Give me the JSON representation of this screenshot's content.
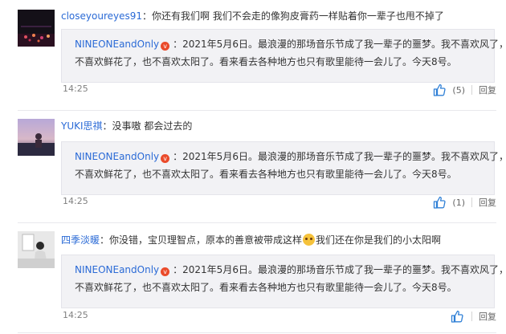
{
  "comments": [
    {
      "username": "closeyoureyes91",
      "text": "：你还有我们啊 我们不会走的像狗皮膏药一样贴着你一辈子也甩不掉了",
      "quote": {
        "username": "NINEONEandOnly",
        "badge": "v",
        "line1": "：2021年5月6日。最浪漫的那场音乐节成了我一辈子的噩梦。我不喜欢风了，",
        "line2": "不喜欢鲜花了，也不喜欢太阳了。看来看去各种地方也只有歌里能待一会儿了。今天8号。"
      },
      "time": "14:25",
      "like_count": "(5)",
      "reply_label": "回复"
    },
    {
      "username": "YUKI思祺",
      "text": "：没事嗷 都会过去的",
      "quote": {
        "username": "NINEONEandOnly",
        "badge": "v",
        "line1": "：2021年5月6日。最浪漫的那场音乐节成了我一辈子的噩梦。我不喜欢风了，",
        "line2": "不喜欢鲜花了，也不喜欢太阳了。看来看去各种地方也只有歌里能待一会儿了。今天8号。"
      },
      "time": "14:25",
      "like_count": "(1)",
      "reply_label": "回复"
    },
    {
      "username": "四季淡暖",
      "text_before_emoji": "：你没错，宝贝理智点，原本的善意被带成这样",
      "emoji": "crying-emoji",
      "text_after_emoji": "我们还在你是我们的小太阳啊",
      "quote": {
        "username": "NINEONEandOnly",
        "badge": "v",
        "line1": "：2021年5月6日。最浪漫的那场音乐节成了我一辈子的噩梦。我不喜欢风了，",
        "line2": "不喜欢鲜花了，也不喜欢太阳了。看来看去各种地方也只有歌里能待一会儿了。今天8号。"
      },
      "time": "14:25",
      "like_count": "",
      "reply_label": "回复"
    }
  ],
  "icons": {
    "like": "thumbs-up-icon"
  },
  "colors": {
    "username": "#2a6ad6",
    "quote_bg": "#f2f2f5",
    "vip_badge": "#ea4a2a"
  }
}
